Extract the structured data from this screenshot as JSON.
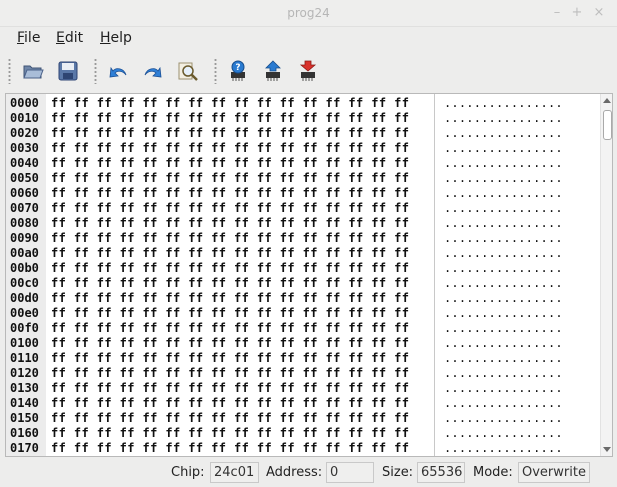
{
  "window": {
    "title": "prog24"
  },
  "menu": [
    {
      "label": "File",
      "mnemonic": "F",
      "rest": "ile"
    },
    {
      "label": "Edit",
      "mnemonic": "E",
      "rest": "dit"
    },
    {
      "label": "Help",
      "mnemonic": "H",
      "rest": "elp"
    }
  ],
  "toolbar": [
    "open-folder-icon",
    "save-disk-icon",
    "undo-icon",
    "redo-icon",
    "find-icon",
    "chip-info-icon",
    "chip-read-icon",
    "chip-write-icon"
  ],
  "hex": {
    "addresses": [
      "0000",
      "0010",
      "0020",
      "0030",
      "0040",
      "0050",
      "0060",
      "0070",
      "0080",
      "0090",
      "00a0",
      "00b0",
      "00c0",
      "00d0",
      "00e0",
      "00f0",
      "0100",
      "0110",
      "0120",
      "0130",
      "0140",
      "0150",
      "0160",
      "0170"
    ],
    "byte": "ff",
    "bytes_per_row": 16,
    "ascii_char": "."
  },
  "status": {
    "chip_label": "Chip:",
    "chip_value": "24c01",
    "address_label": "Address:",
    "address_value": "0",
    "size_label": "Size:",
    "size_value": "65536",
    "mode_label": "Mode:",
    "mode_value": "Overwrite"
  }
}
